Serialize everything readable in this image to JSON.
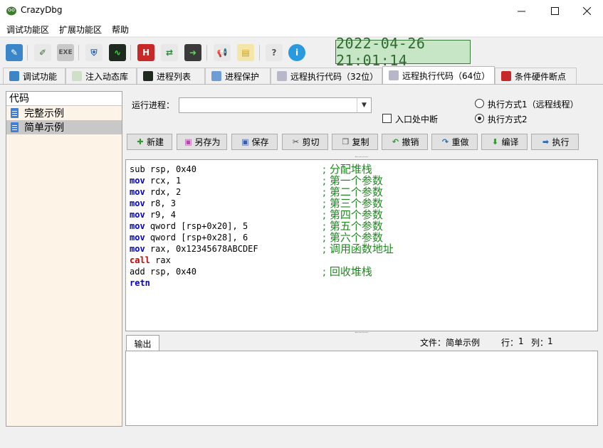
{
  "app": {
    "title": "CrazyDbg"
  },
  "menu": [
    "调试功能区",
    "扩展功能区",
    "帮助"
  ],
  "clock": "2022-04-26 21:01:14",
  "tabs": [
    "调试功能",
    "注入动态库",
    "进程列表",
    "进程保护",
    "远程执行代码（32位）",
    "远程执行代码（64位）",
    "条件硬件断点"
  ],
  "active_tab_index": 5,
  "left_panel": {
    "header": "代码",
    "items": [
      "完整示例",
      "简单示例"
    ],
    "selected_index": 1
  },
  "process": {
    "label": "运行进程：",
    "value": ""
  },
  "breakpoint_checkbox": {
    "label": "入口处中断",
    "checked": false
  },
  "exec_modes": {
    "options": [
      "执行方式1（远程线程）",
      "执行方式2"
    ],
    "selected_index": 1
  },
  "buttons": [
    "新建",
    "另存为",
    "保存",
    "剪切",
    "复制",
    "撤销",
    "重做",
    "编译",
    "执行"
  ],
  "code": [
    {
      "kw": "sub",
      "kwtype": "plain",
      "rest": " rsp, 0x40",
      "comment": "; 分配堆栈"
    },
    {
      "kw": "mov",
      "kwtype": "blue",
      "rest": " rcx, 1",
      "comment": "; 第一个参数"
    },
    {
      "kw": "mov",
      "kwtype": "blue",
      "rest": " rdx, 2",
      "comment": "; 第二个参数"
    },
    {
      "kw": "mov",
      "kwtype": "blue",
      "rest": " r8, 3",
      "comment": "; 第三个参数"
    },
    {
      "kw": "mov",
      "kwtype": "blue",
      "rest": " r9, 4",
      "comment": "; 第四个参数"
    },
    {
      "kw": "mov",
      "kwtype": "blue",
      "rest": " qword [rsp+0x20], 5",
      "comment": "; 第五个参数"
    },
    {
      "kw": "mov",
      "kwtype": "blue",
      "rest": " qword [rsp+0x28], 6",
      "comment": "; 第六个参数"
    },
    {
      "kw": "mov",
      "kwtype": "blue",
      "rest": " rax, 0x12345678ABCDEF",
      "comment": "; 调用函数地址"
    },
    {
      "kw": "call",
      "kwtype": "red",
      "rest": " rax",
      "comment": ""
    },
    {
      "kw": "add",
      "kwtype": "plain",
      "rest": " rsp, 0x40",
      "comment": "; 回收堆栈"
    },
    {
      "kw": "retn",
      "kwtype": "blue",
      "rest": "",
      "comment": ""
    }
  ],
  "output": {
    "tab_label": "输出",
    "status_file_label": "文件：",
    "status_file": "简单示例",
    "status_row_label": "行：",
    "status_row": "1",
    "status_col_label": "列：",
    "status_col": "1"
  }
}
